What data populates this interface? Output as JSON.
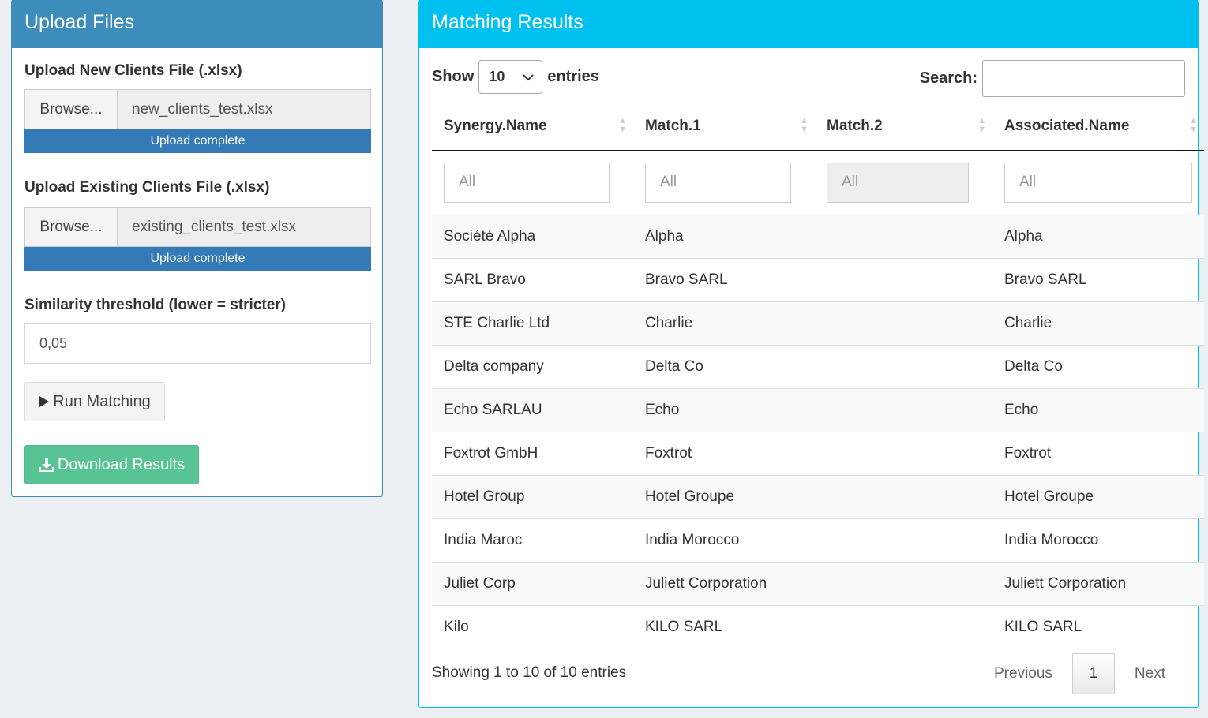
{
  "upload_panel": {
    "title": "Upload Files",
    "new_clients": {
      "label": "Upload New Clients File (.xlsx)",
      "browse_label": "Browse...",
      "file_name": "new_clients_test.xlsx",
      "progress_text": "Upload complete",
      "progress": 1.0
    },
    "existing_clients": {
      "label": "Upload Existing Clients File (.xlsx)",
      "browse_label": "Browse...",
      "file_name": "existing_clients_test.xlsx",
      "progress_text": "Upload complete",
      "progress": 1.0
    },
    "threshold": {
      "label": "Similarity threshold (lower = stricter)",
      "value": "0,05"
    },
    "run_button": {
      "icon": "play-icon",
      "label": "Run Matching"
    },
    "download_button": {
      "icon": "download-icon",
      "label": "Download Results"
    }
  },
  "results_panel": {
    "title": "Matching Results",
    "show_label": "Show",
    "page_length": "10",
    "entries_label": "entries",
    "search_label": "Search:",
    "search_value": "",
    "columns": [
      "Synergy.Name",
      "Match.1",
      "Match.2",
      "Associated.Name"
    ],
    "filters": [
      "All",
      "All",
      "All",
      "All"
    ],
    "rows": [
      [
        "Société Alpha",
        "Alpha",
        "",
        "Alpha"
      ],
      [
        "SARL Bravo",
        "Bravo SARL",
        "",
        "Bravo SARL"
      ],
      [
        "STE Charlie Ltd",
        "Charlie",
        "",
        "Charlie"
      ],
      [
        "Delta company",
        "Delta Co",
        "",
        "Delta Co"
      ],
      [
        "Echo SARLAU",
        "Echo",
        "",
        "Echo"
      ],
      [
        "Foxtrot GmbH",
        "Foxtrot",
        "",
        "Foxtrot"
      ],
      [
        "Hotel Group",
        "Hotel Groupe",
        "",
        "Hotel Groupe"
      ],
      [
        "India Maroc",
        "India Morocco",
        "",
        "India Morocco"
      ],
      [
        "Juliet Corp",
        "Juliett Corporation",
        "",
        "Juliett Corporation"
      ],
      [
        "Kilo",
        "KILO SARL",
        "",
        "KILO SARL"
      ]
    ],
    "info": "Showing 1 to 10 of 10 entries",
    "pagination": {
      "previous": "Previous",
      "current": "1",
      "next": "Next"
    }
  },
  "colors": {
    "primary": "#3c8dbc",
    "info": "#00c0ef",
    "success": "#00a65a",
    "progress": "#337ab7",
    "background": "#ecf0f5"
  }
}
